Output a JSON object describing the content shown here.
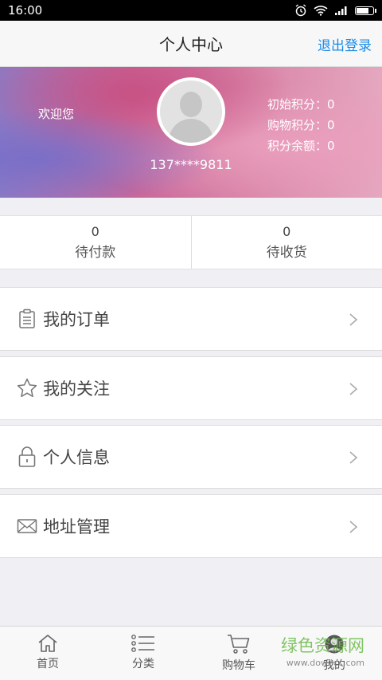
{
  "status": {
    "time": "16:00"
  },
  "header": {
    "title": "个人中心",
    "logout_label": "退出登录"
  },
  "profile": {
    "welcome": "欢迎您",
    "phone": "137****9811",
    "points": [
      {
        "label": "初始积分：0"
      },
      {
        "label": "购物积分：0"
      },
      {
        "label": "积分余额：0"
      }
    ]
  },
  "pending": [
    {
      "count": "0",
      "label": "待付款"
    },
    {
      "count": "0",
      "label": "待收货"
    }
  ],
  "menu": [
    {
      "label": "我的订单",
      "icon": "clipboard-icon"
    },
    {
      "label": "我的关注",
      "icon": "star-icon"
    },
    {
      "label": "个人信息",
      "icon": "lock-icon"
    },
    {
      "label": "地址管理",
      "icon": "envelope-icon"
    }
  ],
  "tabs": [
    {
      "label": "首页",
      "icon": "home-icon"
    },
    {
      "label": "分类",
      "icon": "list-icon"
    },
    {
      "label": "购物车",
      "icon": "cart-icon"
    },
    {
      "label": "我的",
      "icon": "user-icon"
    }
  ],
  "watermark": {
    "text": "绿色资源网",
    "sub": "www.downcc.com"
  },
  "colors": {
    "accent": "#1a8be8",
    "background": "#efeff4",
    "watermark": "#6dbb4b"
  }
}
